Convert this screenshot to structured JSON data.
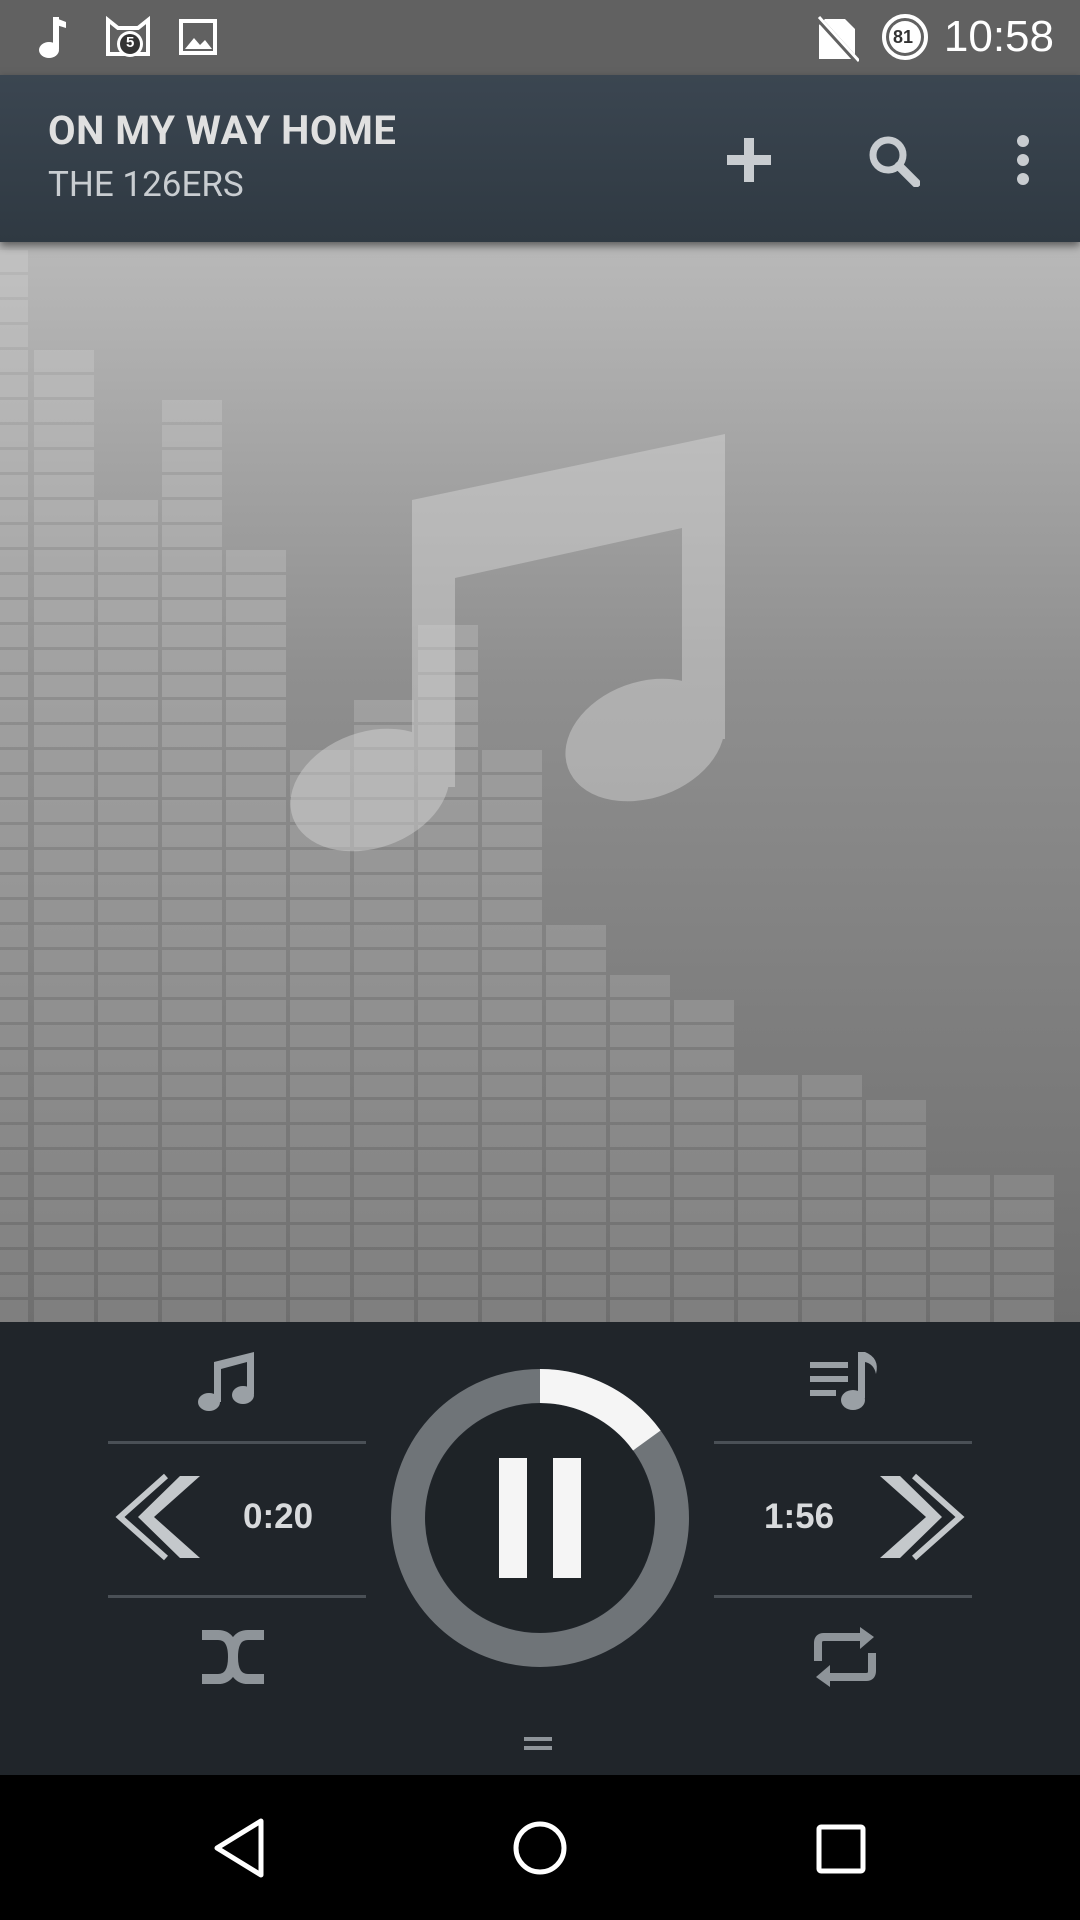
{
  "status_bar": {
    "time": "10:58",
    "battery_level": "81",
    "notification_badge": "5",
    "icons": [
      "music-note-icon",
      "cat-notification-icon",
      "image-icon",
      "no-sim-icon",
      "battery-icon"
    ]
  },
  "now_playing": {
    "title": "ON MY WAY HOME",
    "artist": "THE 126ERS"
  },
  "actions": [
    "add-icon",
    "search-icon",
    "more-vert-icon"
  ],
  "playback": {
    "elapsed": "0:20",
    "remaining": "1:56",
    "progress": 0.15,
    "state": "playing"
  },
  "colors": {
    "app_bar": "#343f49",
    "controls_bg": "#20252a",
    "progress_track": "#6f7478",
    "progress_fill": "#f5f5f5"
  }
}
